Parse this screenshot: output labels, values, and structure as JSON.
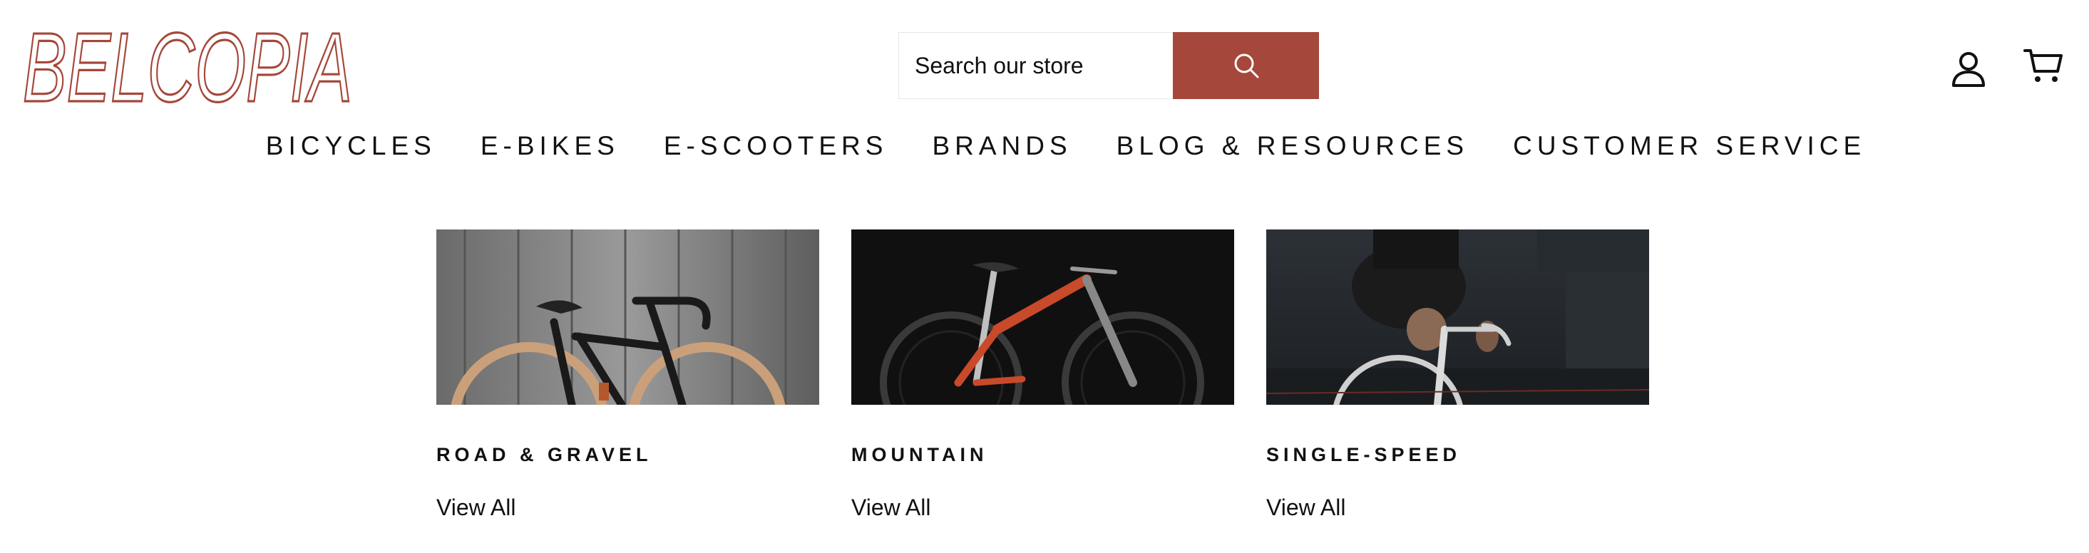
{
  "logo": {
    "text": "BELCOPIA",
    "color": "#a5473a"
  },
  "search": {
    "placeholder": "Search our store",
    "button_color": "#a5473a"
  },
  "header_icons": {
    "account": "user-icon",
    "cart": "cart-icon"
  },
  "nav": {
    "items": [
      {
        "label": "BICYCLES"
      },
      {
        "label": "E-BIKES"
      },
      {
        "label": "E-SCOOTERS"
      },
      {
        "label": "BRANDS"
      },
      {
        "label": "BLOG & RESOURCES"
      },
      {
        "label": "CUSTOMER SERVICE"
      }
    ]
  },
  "categories": [
    {
      "title": "ROAD & GRAVEL",
      "link": "View All",
      "image": "road-gravel-bike-photo"
    },
    {
      "title": "MOUNTAIN",
      "link": "View All",
      "image": "mountain-bike-photo"
    },
    {
      "title": "SINGLE-SPEED",
      "link": "View All",
      "image": "single-speed-rider-photo"
    }
  ]
}
